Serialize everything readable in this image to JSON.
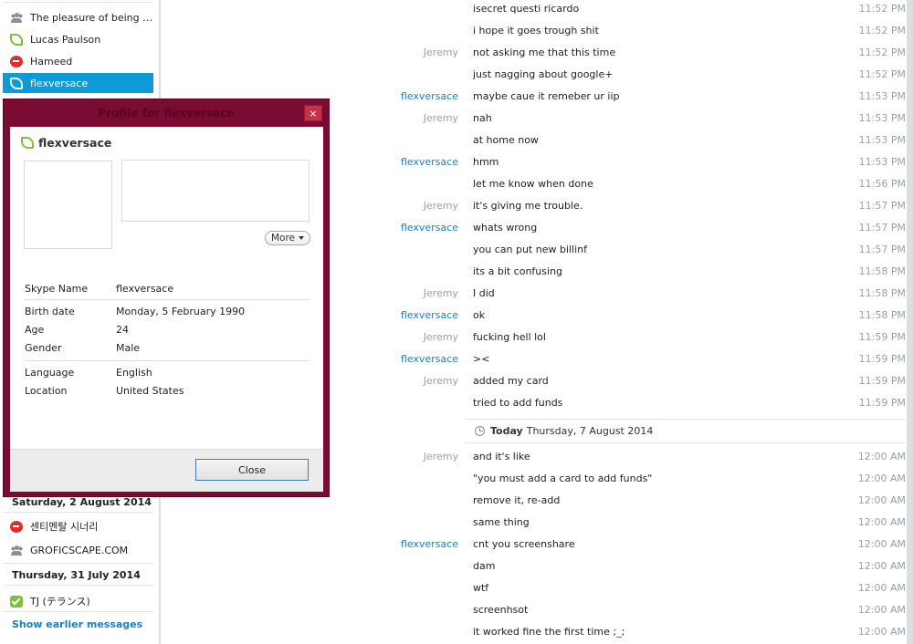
{
  "sidebar": {
    "contacts": [
      {
        "name": "The pleasure of being cu...",
        "icon": "group-icon",
        "selected": false
      },
      {
        "name": "Lucas Paulson",
        "icon": "online-status-icon",
        "selected": false
      },
      {
        "name": "Hameed",
        "icon": "do-not-disturb-icon",
        "selected": false
      },
      {
        "name": "flexversace",
        "icon": "online-status-icon",
        "selected": true
      }
    ],
    "groups": [
      {
        "date": "Saturday, 2 August 2014",
        "items": [
          {
            "name": "센티멘탈 시너리",
            "icon": "do-not-disturb-icon"
          },
          {
            "name": "GROFICSCAPE.COM",
            "icon": "group-icon"
          }
        ]
      },
      {
        "date": "Thursday, 31 July 2014",
        "items": [
          {
            "name": "TJ (テランス)",
            "icon": "online-check-icon"
          }
        ]
      }
    ],
    "show_earlier": "Show earlier messages"
  },
  "profile_dialog": {
    "title": "Profile for flexversace",
    "close_x": "×",
    "display_name": "flexversace",
    "more_label": "More",
    "fields": [
      {
        "label": "Skype Name",
        "value": "flexversace"
      },
      {
        "label": "Birth date",
        "value": "Monday, 5 February 1990"
      },
      {
        "label": "Age",
        "value": "24"
      },
      {
        "label": "Gender",
        "value": "Male"
      },
      {
        "label": "Language",
        "value": "English"
      },
      {
        "label": "Location",
        "value": "United States"
      }
    ],
    "close_button": "Close",
    "colors": {
      "frame": "#7a0b32",
      "close_x": "#c7324b"
    }
  },
  "chat": {
    "messages_before": [
      {
        "sender": "",
        "text": "isecret questi ricardo",
        "time": "11:52 PM"
      },
      {
        "sender": "",
        "text": "i hope it goes trough shit",
        "time": "11:52 PM"
      },
      {
        "sender": "Jeremy",
        "text": "not asking me that this time",
        "time": "11:52 PM"
      },
      {
        "sender": "",
        "text": "just nagging about google+",
        "time": "11:52 PM"
      },
      {
        "sender": "flexversace",
        "text": "maybe caue it remeber ur iip",
        "time": "11:53 PM"
      },
      {
        "sender": "Jeremy",
        "text": "nah",
        "time": "11:53 PM"
      },
      {
        "sender": "",
        "text": "at home now",
        "time": "11:53 PM"
      },
      {
        "sender": "flexversace",
        "text": "hmm",
        "time": "11:53 PM"
      },
      {
        "sender": "",
        "text": "let me know when done",
        "time": "11:56 PM"
      },
      {
        "sender": "Jeremy",
        "text": "it's giving me trouble.",
        "time": "11:57 PM"
      },
      {
        "sender": "flexversace",
        "text": "whats wrong",
        "time": "11:57 PM"
      },
      {
        "sender": "",
        "text": "you can put new billinf",
        "time": "11:57 PM"
      },
      {
        "sender": "",
        "text": "its a bit confusing",
        "time": "11:58 PM"
      },
      {
        "sender": "Jeremy",
        "text": "I did",
        "time": "11:58 PM"
      },
      {
        "sender": "flexversace",
        "text": "ok",
        "time": "11:58 PM"
      },
      {
        "sender": "Jeremy",
        "text": "fucking hell lol",
        "time": "11:59 PM"
      },
      {
        "sender": "flexversace",
        "text": "><",
        "time": "11:59 PM"
      },
      {
        "sender": "Jeremy",
        "text": "added my card",
        "time": "11:59 PM"
      },
      {
        "sender": "",
        "text": "tried to add funds",
        "time": "11:59 PM"
      }
    ],
    "day_divider": {
      "bold": "Today",
      "date": "Thursday, 7 August 2014"
    },
    "messages_after": [
      {
        "sender": "Jeremy",
        "text": "and it's like",
        "time": "12:00 AM"
      },
      {
        "sender": "",
        "text": "\"you must add a card to add funds\"",
        "time": "12:00 AM"
      },
      {
        "sender": "",
        "text": "remove it, re-add",
        "time": "12:00 AM"
      },
      {
        "sender": "",
        "text": "same thing",
        "time": "12:00 AM"
      },
      {
        "sender": "flexversace",
        "text": "cnt you screenshare",
        "time": "12:00 AM"
      },
      {
        "sender": "",
        "text": "dam",
        "time": "12:00 AM"
      },
      {
        "sender": "",
        "text": "wtf",
        "time": "12:00 AM"
      },
      {
        "sender": "",
        "text": "screenhsot",
        "time": "12:00 AM"
      },
      {
        "sender": "",
        "text": "it worked fine the first time ;_;",
        "time": "12:00 AM"
      }
    ]
  }
}
